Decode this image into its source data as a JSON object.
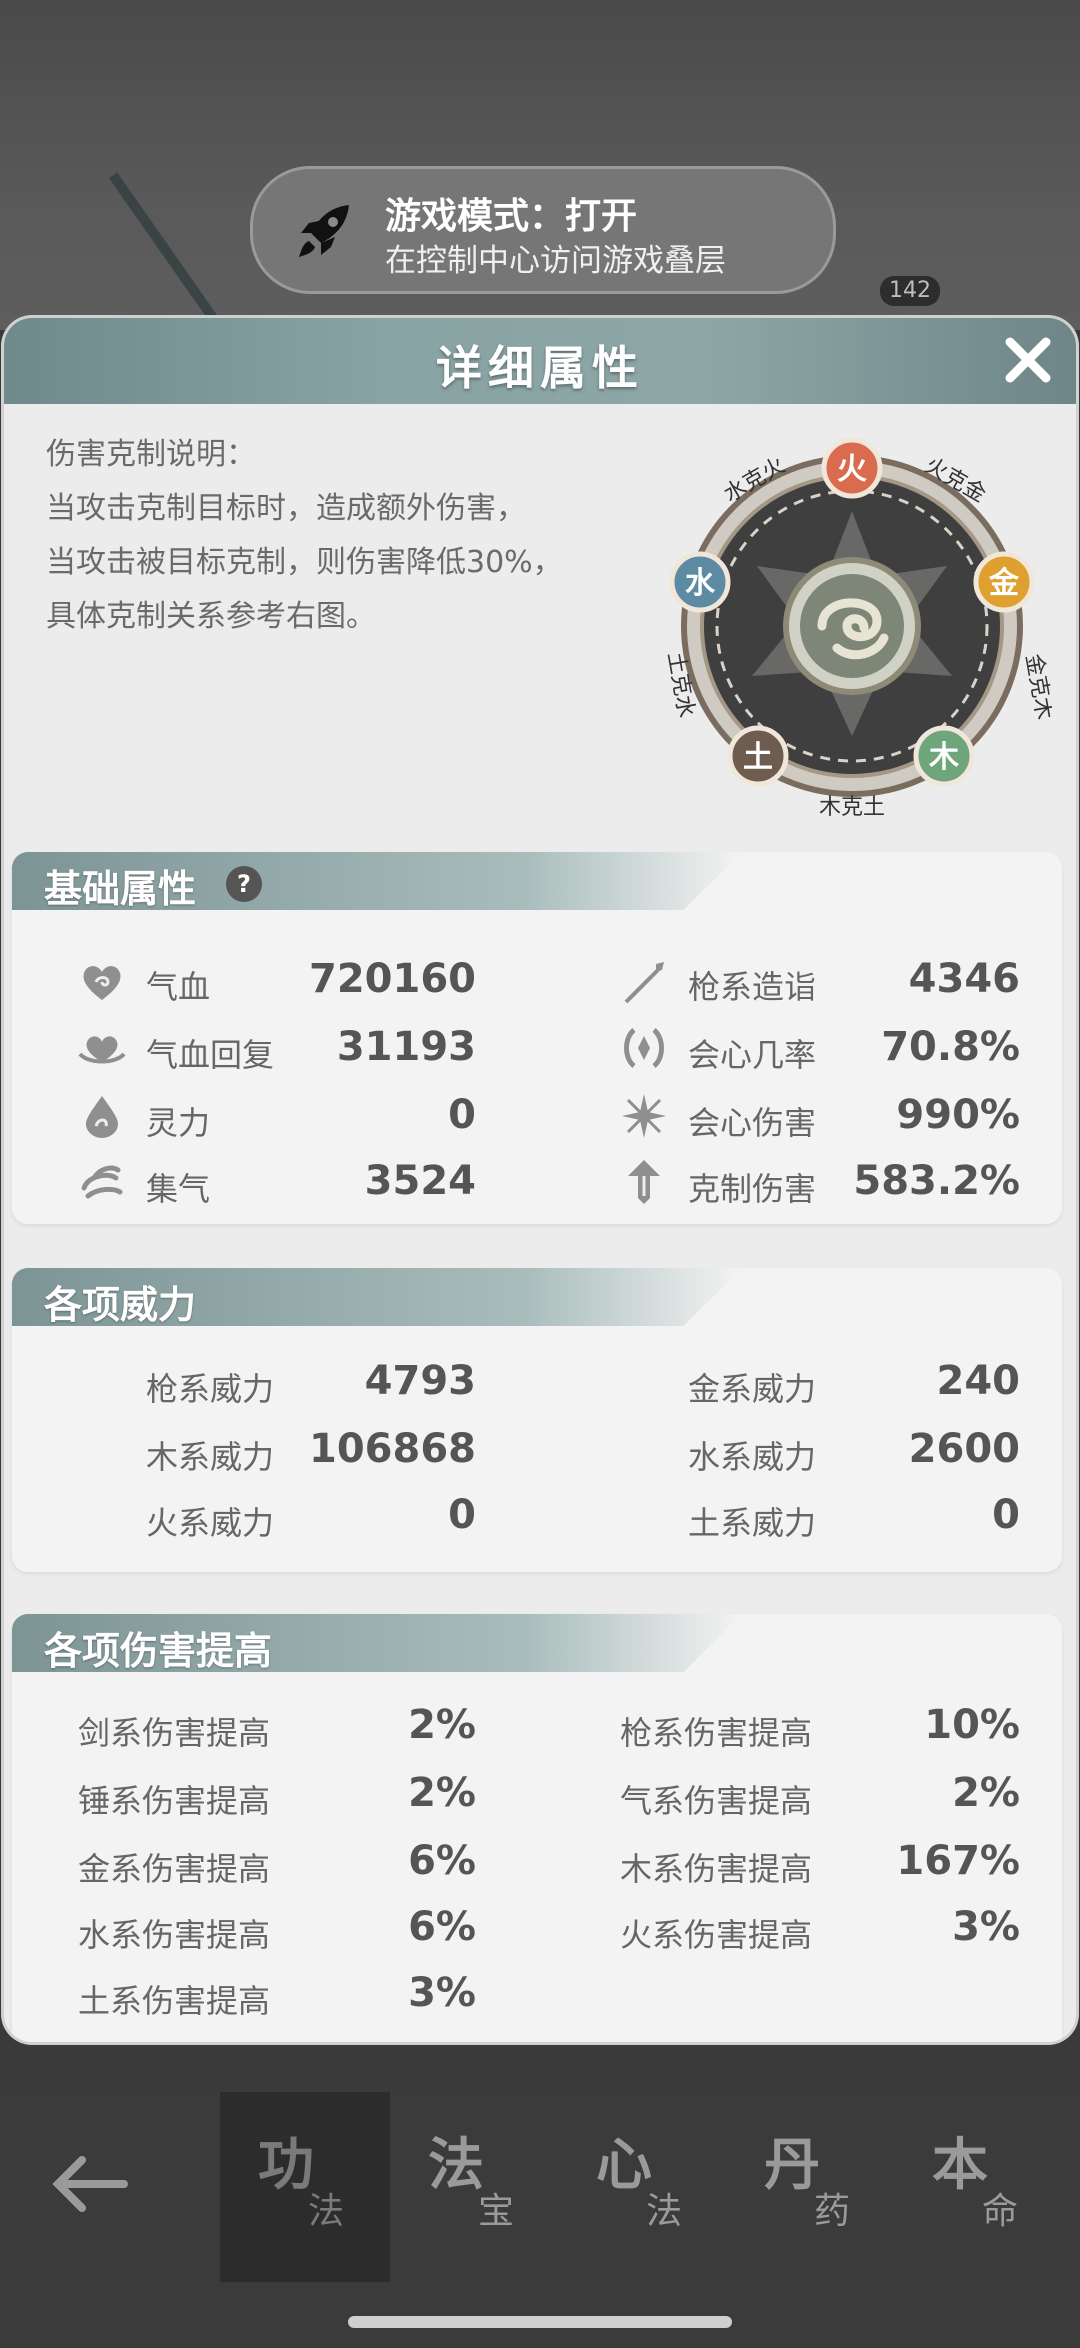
{
  "toast": {
    "title": "游戏模式：打开",
    "subtitle": "在控制中心访问游戏叠层",
    "icon": "rocket-icon"
  },
  "background": {
    "badge": "142"
  },
  "panel": {
    "title": "详细属性",
    "close_icon": "close-icon"
  },
  "explanation": {
    "lines": [
      "伤害克制说明：",
      "当攻击克制目标时，造成额外伤害，",
      "当攻击被目标克制，则伤害降低30%，",
      "具体克制关系参考右图。"
    ]
  },
  "wheel": {
    "elements": {
      "fire": "火",
      "metal": "金",
      "wood": "木",
      "earth": "土",
      "water": "水"
    },
    "relations": {
      "fire_metal": "火克金",
      "metal_wood": "金克木",
      "wood_earth": "木克土",
      "earth_water": "土克水",
      "water_fire": "水克火"
    },
    "colors": {
      "fire": "#d96b4e",
      "metal": "#e0a030",
      "wood": "#6fa57a",
      "earth": "#6e5d4e",
      "water": "#5c8ba3"
    }
  },
  "basic": {
    "title": "基础属性",
    "help": "?",
    "left": [
      {
        "label": "气血",
        "value": "720160",
        "icon": "heart-icon"
      },
      {
        "label": "气血回复",
        "value": "31193",
        "icon": "heart-regen-icon"
      },
      {
        "label": "灵力",
        "value": "0",
        "icon": "spirit-drop-icon"
      },
      {
        "label": "集气",
        "value": "3524",
        "icon": "swirl-icon"
      }
    ],
    "right": [
      {
        "label": "枪系造诣",
        "value": "4346",
        "icon": "spear-icon"
      },
      {
        "label": "会心几率",
        "value": "70.8%",
        "icon": "crit-rate-icon"
      },
      {
        "label": "会心伤害",
        "value": "990%",
        "icon": "crit-damage-icon"
      },
      {
        "label": "克制伤害",
        "value": "583.2%",
        "icon": "counter-damage-icon"
      }
    ]
  },
  "power": {
    "title": "各项威力",
    "left": [
      {
        "label": "枪系威力",
        "value": "4793"
      },
      {
        "label": "木系威力",
        "value": "106868"
      },
      {
        "label": "火系威力",
        "value": "0"
      }
    ],
    "right": [
      {
        "label": "金系威力",
        "value": "240"
      },
      {
        "label": "水系威力",
        "value": "2600"
      },
      {
        "label": "土系威力",
        "value": "0"
      }
    ]
  },
  "damage": {
    "title": "各项伤害提高",
    "left": [
      {
        "label": "剑系伤害提高",
        "value": "2%"
      },
      {
        "label": "锤系伤害提高",
        "value": "2%"
      },
      {
        "label": "金系伤害提高",
        "value": "6%"
      },
      {
        "label": "水系伤害提高",
        "value": "6%"
      },
      {
        "label": "土系伤害提高",
        "value": "3%"
      }
    ],
    "right": [
      {
        "label": "枪系伤害提高",
        "value": "10%"
      },
      {
        "label": "气系伤害提高",
        "value": "2%"
      },
      {
        "label": "木系伤害提高",
        "value": "167%"
      },
      {
        "label": "火系伤害提高",
        "value": "3%"
      }
    ]
  },
  "nav": {
    "tabs": [
      {
        "big": "功",
        "small": "法"
      },
      {
        "big": "法",
        "small": "宝"
      },
      {
        "big": "心",
        "small": "法"
      },
      {
        "big": "丹",
        "small": "药"
      },
      {
        "big": "本",
        "small": "命"
      }
    ]
  }
}
